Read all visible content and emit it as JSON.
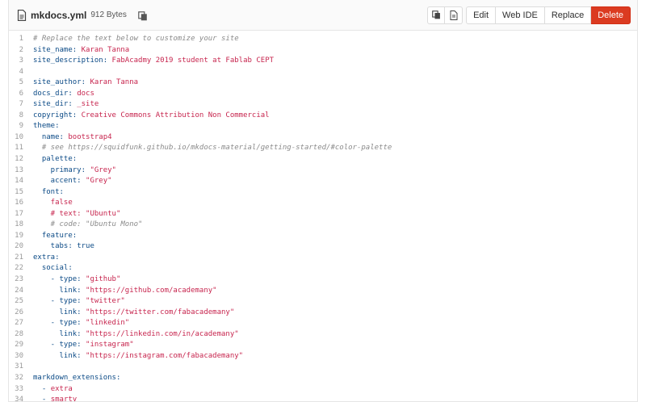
{
  "file": {
    "name": "mkdocs.yml",
    "size": "912 Bytes"
  },
  "toolbar": {
    "edit": "Edit",
    "web_ide": "Web IDE",
    "replace": "Replace",
    "delete": "Delete"
  },
  "colors": {
    "delete_bg": "#db3b21",
    "comment": "#8a8a8a",
    "string": "#c7254e",
    "key": "#0b4a86"
  },
  "lines": [
    {
      "n": "1",
      "segs": [
        [
          "c",
          "# Replace the text below to customize your site"
        ]
      ]
    },
    {
      "n": "2",
      "segs": [
        [
          "k",
          "site_name: "
        ],
        [
          "s",
          "Karan Tanna"
        ]
      ]
    },
    {
      "n": "3",
      "segs": [
        [
          "k",
          "site_description: "
        ],
        [
          "s",
          "FabAcadmy 2019 student at Fablab CEPT"
        ]
      ]
    },
    {
      "n": "4",
      "segs": []
    },
    {
      "n": "5",
      "segs": [
        [
          "k",
          "site_author: "
        ],
        [
          "s",
          "Karan Tanna"
        ]
      ]
    },
    {
      "n": "6",
      "segs": [
        [
          "k",
          "docs_dir: "
        ],
        [
          "s",
          "docs"
        ]
      ]
    },
    {
      "n": "7",
      "segs": [
        [
          "k",
          "site_dir: "
        ],
        [
          "s",
          "_site"
        ]
      ]
    },
    {
      "n": "8",
      "segs": [
        [
          "k",
          "copyright: "
        ],
        [
          "s",
          "Creative Commons Attribution Non Commercial"
        ]
      ]
    },
    {
      "n": "9",
      "segs": [
        [
          "k",
          "theme:"
        ]
      ]
    },
    {
      "n": "10",
      "segs": [
        [
          "k",
          "  name: "
        ],
        [
          "s",
          "bootstrap4"
        ]
      ]
    },
    {
      "n": "11",
      "segs": [
        [
          "c",
          "  # see https://squidfunk.github.io/mkdocs-material/getting-started/#color-palette"
        ]
      ]
    },
    {
      "n": "12",
      "segs": [
        [
          "k",
          "  palette:"
        ]
      ]
    },
    {
      "n": "13",
      "segs": [
        [
          "k",
          "    primary: "
        ],
        [
          "s",
          "\"Grey\""
        ]
      ]
    },
    {
      "n": "14",
      "segs": [
        [
          "k",
          "    accent: "
        ],
        [
          "s",
          "\"Grey\""
        ]
      ]
    },
    {
      "n": "15",
      "segs": [
        [
          "k",
          "  font:"
        ]
      ]
    },
    {
      "n": "16",
      "segs": [
        [
          "s",
          "    false"
        ]
      ]
    },
    {
      "n": "17",
      "segs": [
        [
          "s",
          "    # text: \"Ubuntu\""
        ]
      ]
    },
    {
      "n": "18",
      "segs": [
        [
          "c",
          "    # code: \"Ubuntu Mono\""
        ]
      ]
    },
    {
      "n": "19",
      "segs": [
        [
          "k",
          "  feature:"
        ]
      ]
    },
    {
      "n": "20",
      "segs": [
        [
          "k",
          "    tabs: "
        ],
        [
          "k",
          "true"
        ]
      ]
    },
    {
      "n": "21",
      "segs": [
        [
          "k",
          "extra:"
        ]
      ]
    },
    {
      "n": "22",
      "segs": [
        [
          "k",
          "  social:"
        ]
      ]
    },
    {
      "n": "23",
      "segs": [
        [
          "k",
          "    - type: "
        ],
        [
          "s",
          "\"github\""
        ]
      ]
    },
    {
      "n": "24",
      "segs": [
        [
          "k",
          "      link: "
        ],
        [
          "s",
          "\"https://github.com/academany\""
        ]
      ]
    },
    {
      "n": "25",
      "segs": [
        [
          "k",
          "    - type: "
        ],
        [
          "s",
          "\"twitter\""
        ]
      ]
    },
    {
      "n": "26",
      "segs": [
        [
          "k",
          "      link: "
        ],
        [
          "s",
          "\"https://twitter.com/fabacademany\""
        ]
      ]
    },
    {
      "n": "27",
      "segs": [
        [
          "k",
          "    - type: "
        ],
        [
          "s",
          "\"linkedin\""
        ]
      ]
    },
    {
      "n": "28",
      "segs": [
        [
          "k",
          "      link: "
        ],
        [
          "s",
          "\"https://linkedin.com/in/academany\""
        ]
      ]
    },
    {
      "n": "29",
      "segs": [
        [
          "k",
          "    - type: "
        ],
        [
          "s",
          "\"instagram\""
        ]
      ]
    },
    {
      "n": "30",
      "segs": [
        [
          "k",
          "      link: "
        ],
        [
          "s",
          "\"https://instagram.com/fabacademany\""
        ]
      ]
    },
    {
      "n": "31",
      "segs": []
    },
    {
      "n": "32",
      "segs": [
        [
          "k",
          "markdown_extensions:"
        ]
      ]
    },
    {
      "n": "33",
      "segs": [
        [
          "k",
          "  - "
        ],
        [
          "s",
          "extra"
        ]
      ]
    },
    {
      "n": "34",
      "segs": [
        [
          "k",
          "  - "
        ],
        [
          "s",
          "smarty"
        ]
      ]
    }
  ]
}
